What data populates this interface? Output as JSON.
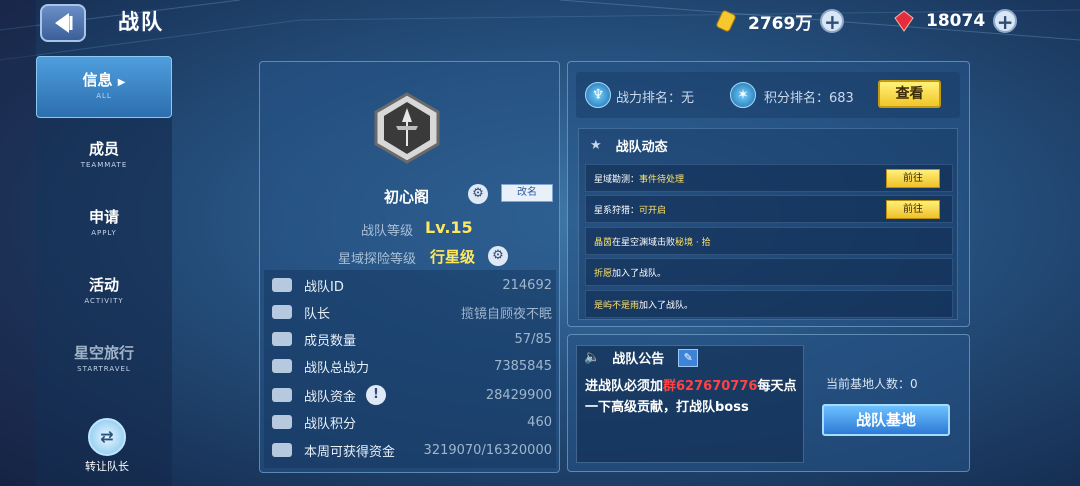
{
  "header": {
    "title": "战队",
    "gold": "2769万",
    "gems": "18074",
    "plus_glyph": "+"
  },
  "nav": {
    "items": [
      {
        "label": "信息",
        "sub": "ALL"
      },
      {
        "label": "成员",
        "sub": "TEAMMATE"
      },
      {
        "label": "申请",
        "sub": "APPLY"
      },
      {
        "label": "活动",
        "sub": "ACTIVITY"
      },
      {
        "label": "星空旅行",
        "sub": "STARTRAVEL"
      }
    ],
    "transfer_label": "转让队长"
  },
  "team": {
    "name": "初心阁",
    "rename_label": "改名",
    "level_label": "战队等级",
    "level_value": "Lv.15",
    "explore_label": "星域探险等级",
    "explore_value": "行星级",
    "stats": [
      {
        "key": "战队ID",
        "value": "214692"
      },
      {
        "key": "队长",
        "value": "揽镜自顾夜不眠"
      },
      {
        "key": "成员数量",
        "value": "57/85"
      },
      {
        "key": "战队总战力",
        "value": "7385845"
      },
      {
        "key": "战队资金",
        "value": "28429900"
      },
      {
        "key": "战队积分",
        "value": "460"
      },
      {
        "key": "本周可获得资金",
        "value": "3219070/16320000"
      }
    ],
    "warn_glyph": "!"
  },
  "ranking": {
    "power_rank": "战力排名：无",
    "score_rank": "积分排名：683",
    "view_label": "查看"
  },
  "dynamics": {
    "title": "战队动态",
    "go_label": "前往",
    "rows": [
      {
        "parts": [
          {
            "t": "星域勘测：",
            "c": "w"
          },
          {
            "t": "事件待处理",
            "c": "y"
          }
        ],
        "btn": true
      },
      {
        "parts": [
          {
            "t": "星系狩猎：",
            "c": "w"
          },
          {
            "t": "可开启",
            "c": "y"
          }
        ],
        "btn": true
      },
      {
        "parts": [
          {
            "t": "晶茵",
            "c": "y"
          },
          {
            "t": "在星空渊域击败",
            "c": "w"
          },
          {
            "t": "秘境 · 拾",
            "c": "y"
          }
        ],
        "btn": false
      },
      {
        "parts": [
          {
            "t": "折愿",
            "c": "y"
          },
          {
            "t": "加入了战队。",
            "c": "w"
          }
        ],
        "btn": false
      },
      {
        "parts": [
          {
            "t": "是屿不是雨",
            "c": "y"
          },
          {
            "t": "加入了战队。",
            "c": "w"
          }
        ],
        "btn": false
      }
    ]
  },
  "notice": {
    "title": "战队公告",
    "text_before": "进战队必须加",
    "group": "群627670776",
    "text_after": "每天点一下高级贡献，打战队boss"
  },
  "base": {
    "count_label": "当前基地人数：0",
    "button_label": "战队基地"
  },
  "colors": {
    "accent_yellow": "#ffe860",
    "button_yellow": "#f1c62a",
    "alert_red": "#ff4343"
  }
}
